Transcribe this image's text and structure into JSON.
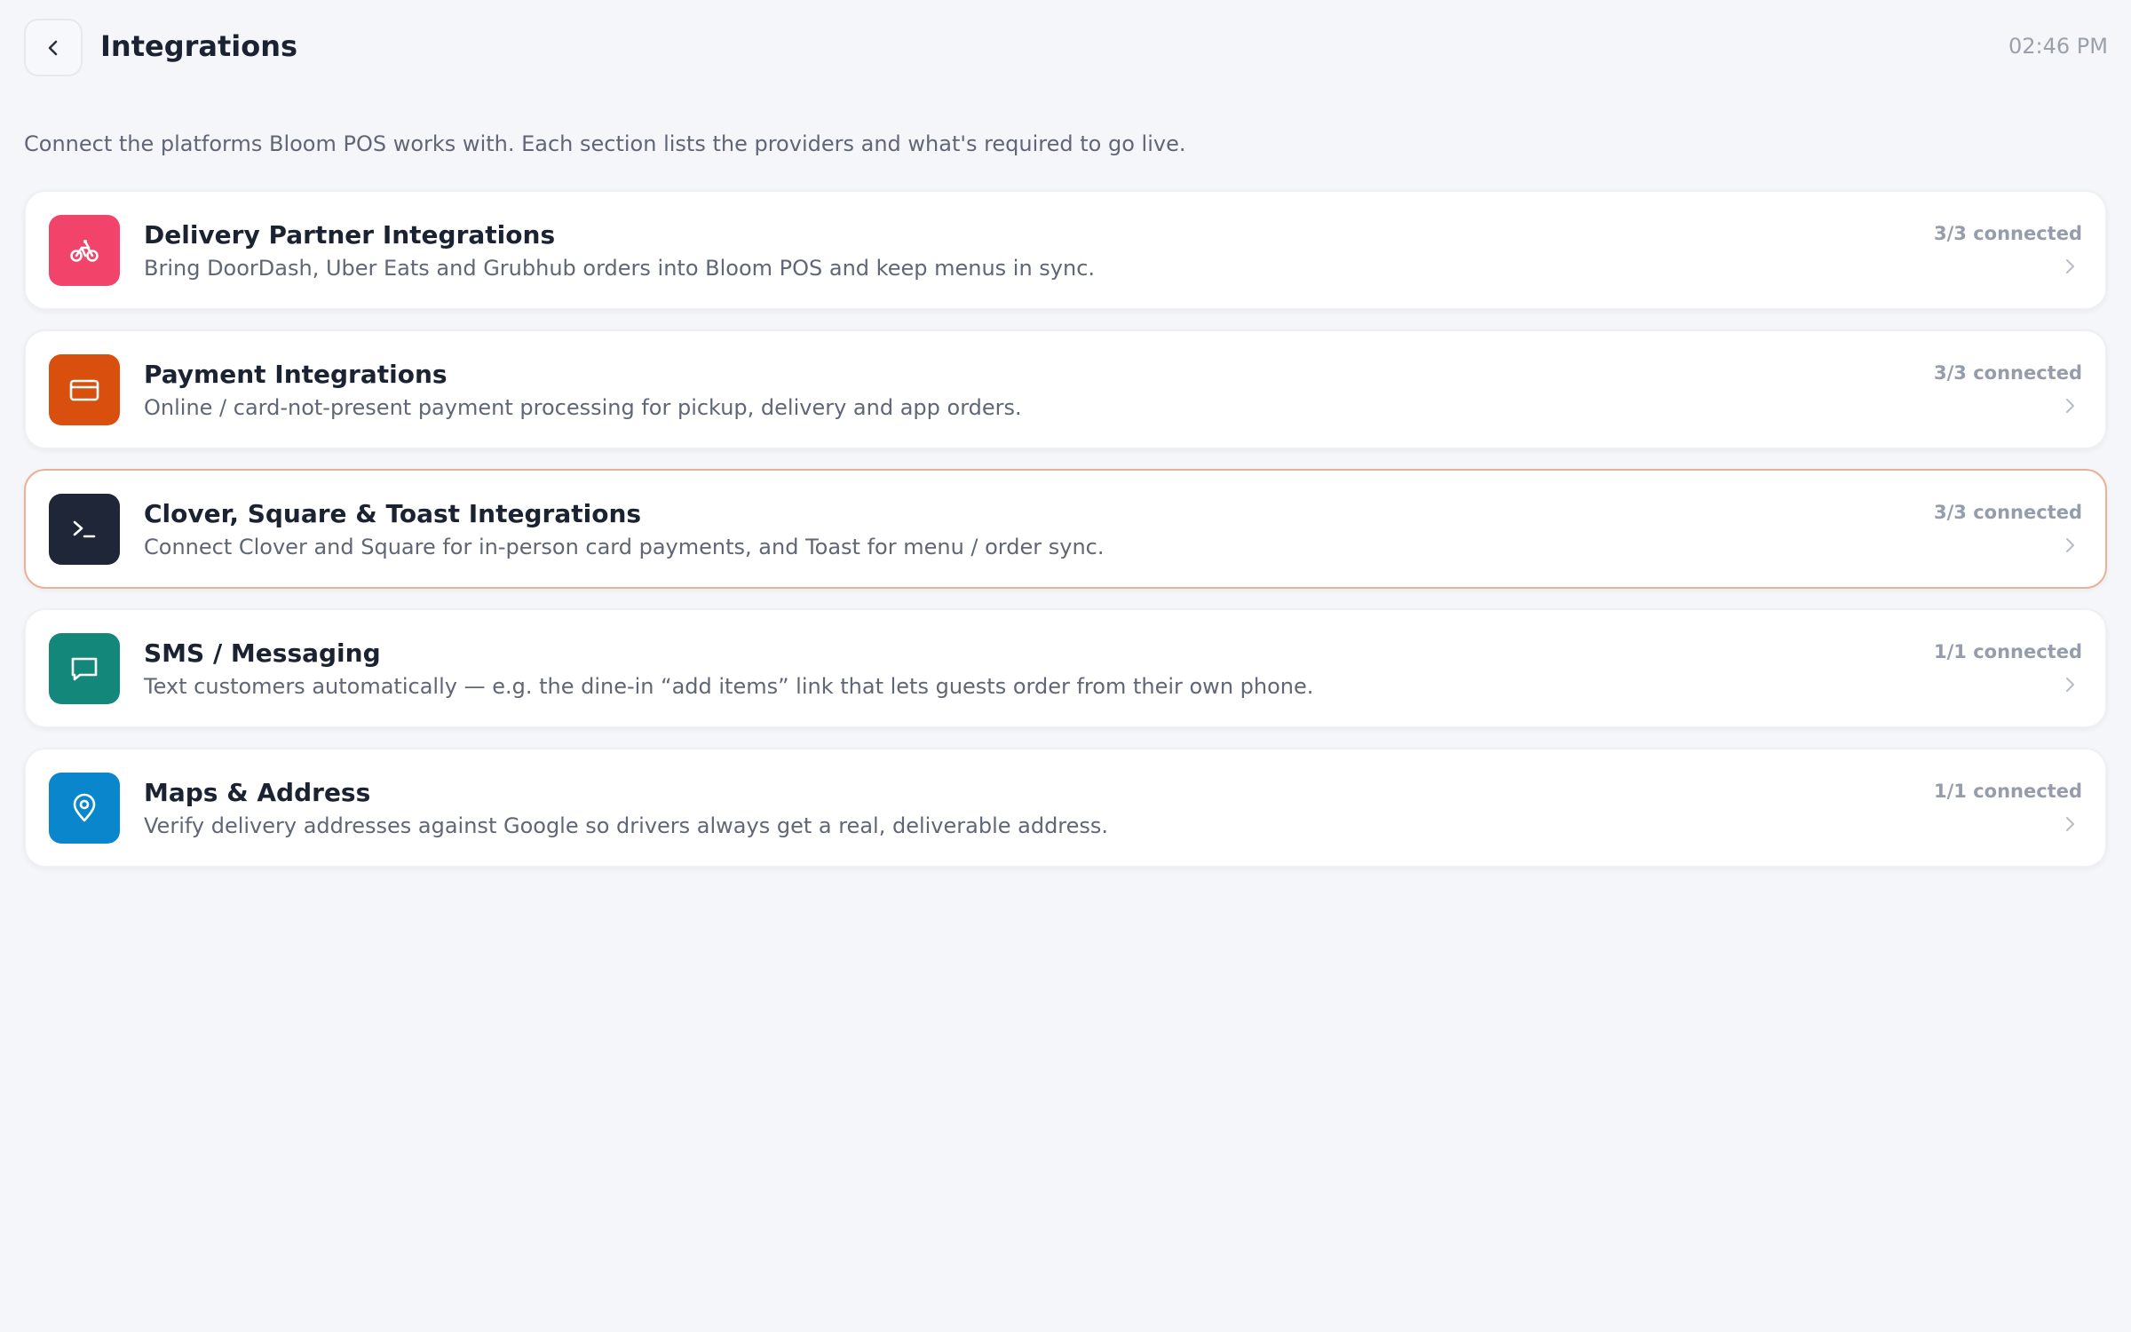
{
  "header": {
    "title": "Integrations",
    "time": "02:46 PM",
    "back_icon": "chevron-left-icon"
  },
  "intro": "Connect the platforms Bloom POS works with. Each section lists the providers and what's required to go live.",
  "integrations": [
    {
      "title": "Delivery Partner Integrations",
      "description": "Bring DoorDash, Uber Eats and Grubhub orders into Bloom POS and keep menus in sync.",
      "status": "3/3 connected",
      "icon": "bike-icon",
      "color": "#f2436a",
      "selected": false
    },
    {
      "title": "Payment Integrations",
      "description": "Online / card-not-present payment processing for pickup, delivery and app orders.",
      "status": "3/3 connected",
      "icon": "credit-card-icon",
      "color": "#d94f0e",
      "selected": false
    },
    {
      "title": "Clover, Square & Toast Integrations",
      "description": "Connect Clover and Square for in-person card payments, and Toast for menu / order sync.",
      "status": "3/3 connected",
      "icon": "terminal-icon",
      "color": "#1e2638",
      "selected": true
    },
    {
      "title": "SMS / Messaging",
      "description": "Text customers automatically — e.g. the dine-in “add items” link that lets guests order from their own phone.",
      "status": "1/1 connected",
      "icon": "message-icon",
      "color": "#13887a",
      "selected": false
    },
    {
      "title": "Maps & Address",
      "description": "Verify delivery addresses against Google so drivers always get a real, deliverable address.",
      "status": "1/1 connected",
      "icon": "map-pin-icon",
      "color": "#0a86cc",
      "selected": false
    }
  ],
  "colors": {
    "background": "#f5f6f9",
    "selected_border": "#eab199",
    "title_text": "#1b2232",
    "muted_text": "#5f6675",
    "status_text": "#959cab"
  }
}
